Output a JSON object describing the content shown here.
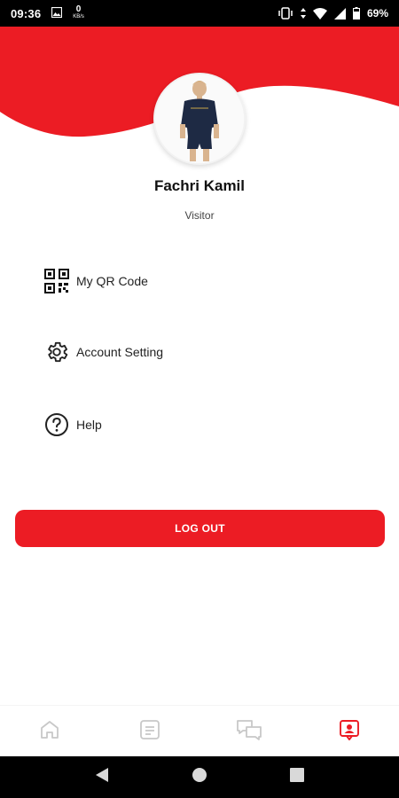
{
  "status_bar": {
    "time": "09:36",
    "network_speed_value": "0",
    "network_speed_unit": "KB/s",
    "battery_percent": "69%",
    "icons": [
      "image-icon",
      "vibrate-icon",
      "wifi-icon",
      "signal-icon",
      "battery-icon"
    ]
  },
  "theme": {
    "accent_color": "#ec1c24",
    "inactive_icon_color": "#c8c8c8"
  },
  "profile": {
    "name": "Fachri Kamil",
    "role": "Visitor",
    "avatar_icon": "profile-photo"
  },
  "menu": {
    "items": [
      {
        "label": "My QR Code",
        "icon": "qr-code-icon"
      },
      {
        "label": "Account Setting",
        "icon": "gear-icon"
      },
      {
        "label": "Help",
        "icon": "help-icon"
      }
    ]
  },
  "logout": {
    "label": "LOG OUT"
  },
  "bottom_nav": {
    "items": [
      {
        "icon": "home-icon",
        "active": false
      },
      {
        "icon": "notes-icon",
        "active": false
      },
      {
        "icon": "chat-icon",
        "active": false
      },
      {
        "icon": "profile-icon",
        "active": true
      }
    ]
  },
  "system_nav": {
    "items": [
      "back-icon",
      "home-circle-icon",
      "recents-icon"
    ]
  }
}
